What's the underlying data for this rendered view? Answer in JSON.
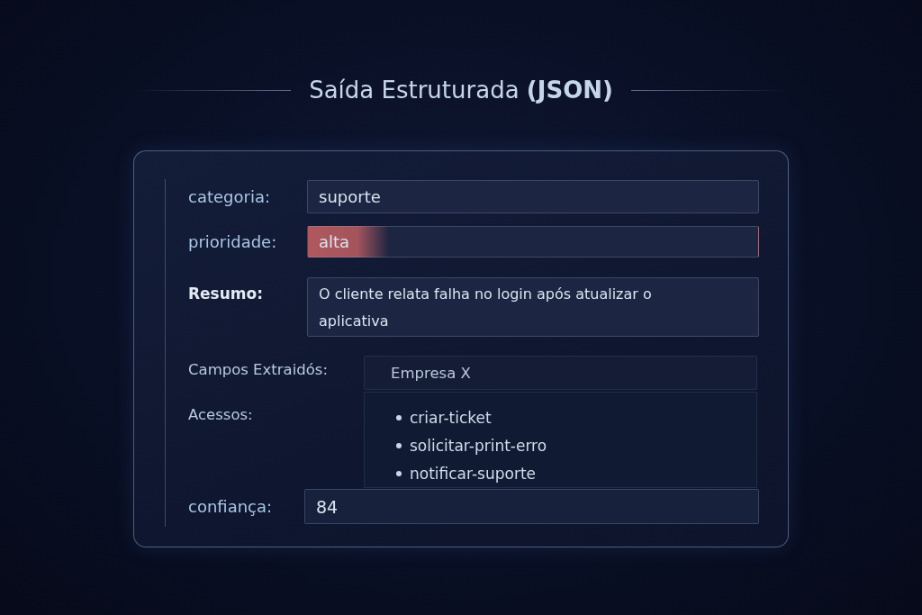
{
  "title": "Saída Estruturada **(JSON)**",
  "fields": [
    {
      "kind": "field",
      "label": "categoria:",
      "value": "suporte",
      "highlighted": false
    },
    {
      "kind": "field",
      "label": "prioridade:",
      "value": "alta",
      "highlighted": true
    },
    {
      "kind": "summary",
      "label": "Resumo:",
      "value": "O cliente relata falha no login após atualizar o aplicativa"
    },
    {
      "kind": "extracted",
      "label": "Campos Extraidós:",
      "value": "Empresa X"
    },
    {
      "kind": "list",
      "label": "Acessos:",
      "items": [
        "criar-ticket",
        "solicitar-print-erro",
        "notificar-suporte"
      ]
    },
    {
      "kind": "score",
      "label": "confiança:",
      "value": "84"
    }
  ]
}
